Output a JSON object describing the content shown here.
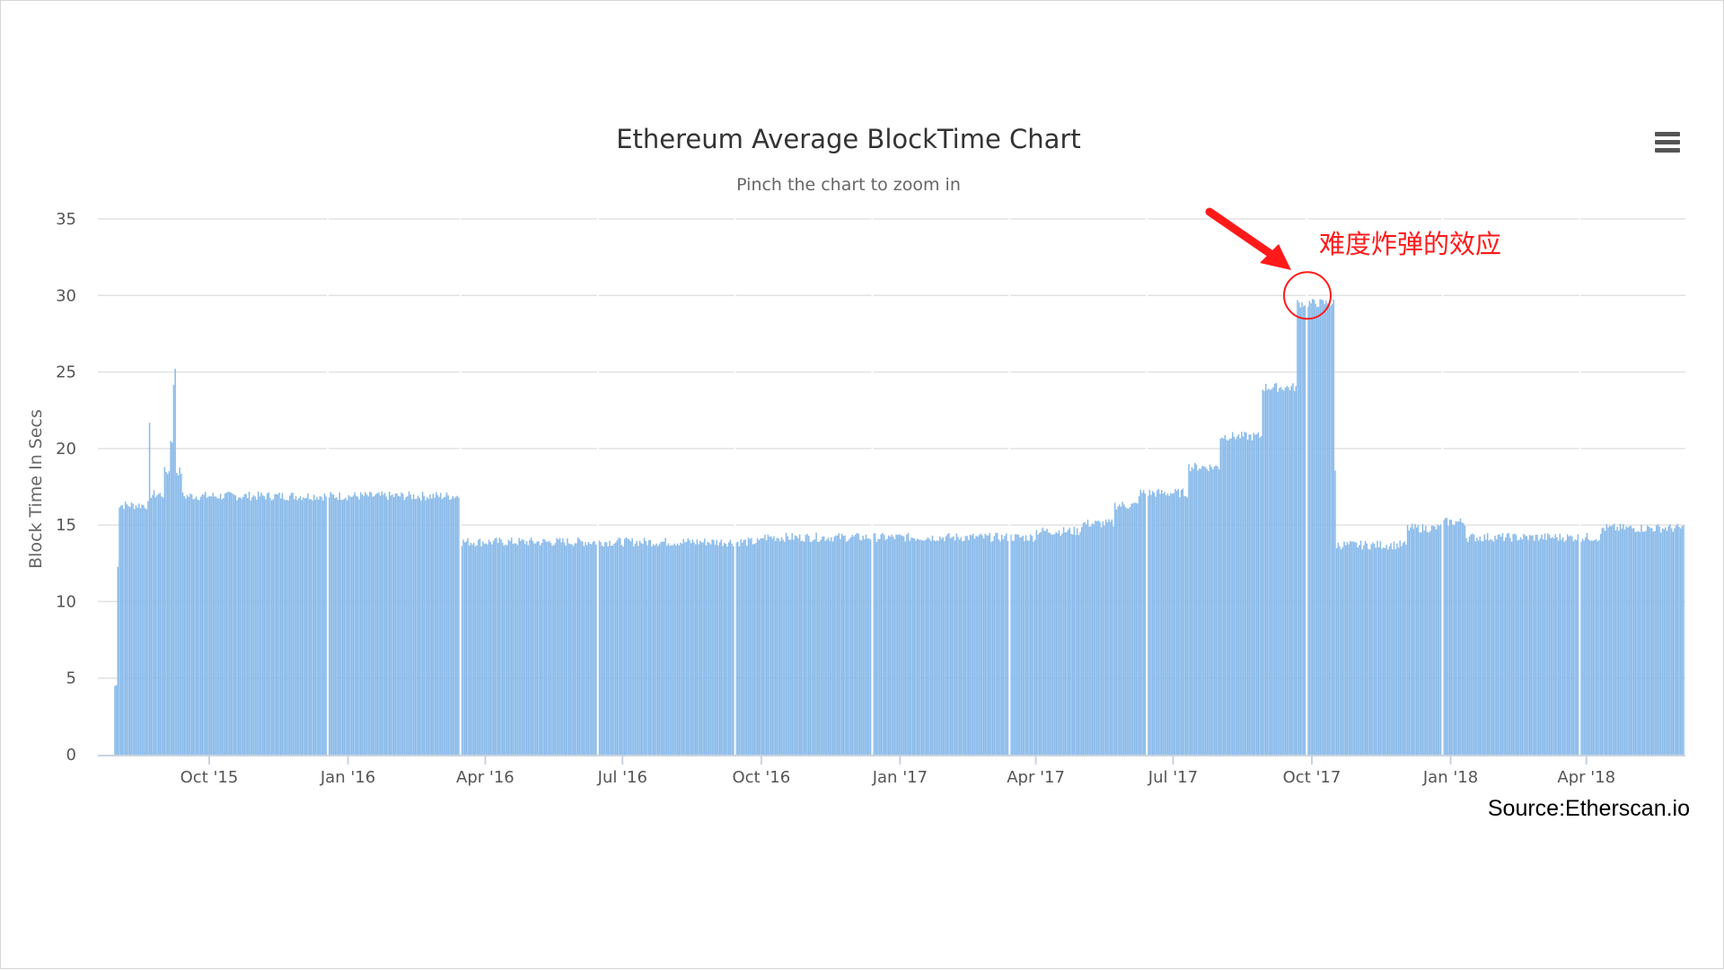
{
  "chart_data": {
    "type": "bar",
    "title": "Ethereum Average BlockTime Chart",
    "subtitle": "Pinch the chart to zoom in",
    "ylabel": "Block Time In Secs",
    "xlabel": "",
    "ylim": [
      0,
      35
    ],
    "yticks": [
      "0",
      "5",
      "10",
      "15",
      "20",
      "25",
      "30",
      "35"
    ],
    "xticks": [
      {
        "label": "Oct '15",
        "date": "2015-10-01"
      },
      {
        "label": "Jan '16",
        "date": "2016-01-01"
      },
      {
        "label": "Apr '16",
        "date": "2016-04-01"
      },
      {
        "label": "Jul '16",
        "date": "2016-07-01"
      },
      {
        "label": "Oct '16",
        "date": "2016-10-01"
      },
      {
        "label": "Jan '17",
        "date": "2017-01-01"
      },
      {
        "label": "Apr '17",
        "date": "2017-04-01"
      },
      {
        "label": "Jul '17",
        "date": "2017-07-01"
      },
      {
        "label": "Oct '17",
        "date": "2017-10-01"
      },
      {
        "label": "Jan '18",
        "date": "2018-01-01"
      },
      {
        "label": "Apr '18",
        "date": "2018-04-01"
      }
    ],
    "xrange": [
      "2015-07-30",
      "2018-06-04"
    ],
    "grid": true,
    "legend": "none",
    "color": "#8bbbea",
    "series": [
      {
        "frequency": "daily",
        "segments": [
          {
            "from": "2015-07-30",
            "to": "2015-07-31",
            "value": 4.5
          },
          {
            "from": "2015-08-01",
            "to": "2015-08-01",
            "value": 12.5
          },
          {
            "from": "2015-08-02",
            "to": "2015-08-21",
            "value": 16.3
          },
          {
            "from": "2015-08-22",
            "to": "2015-08-22",
            "value": 21.4
          },
          {
            "from": "2015-08-23",
            "to": "2015-08-31",
            "value": 17.0
          },
          {
            "from": "2015-09-01",
            "to": "2015-09-04",
            "value": 18.5
          },
          {
            "from": "2015-09-05",
            "to": "2015-09-06",
            "value": 20.6
          },
          {
            "from": "2015-09-07",
            "to": "2015-09-07",
            "value": 24.0
          },
          {
            "from": "2015-09-08",
            "to": "2015-09-08",
            "value": 25.3
          },
          {
            "from": "2015-09-09",
            "to": "2015-09-12",
            "value": 18.5
          },
          {
            "from": "2015-09-13",
            "to": "2016-03-14",
            "value": 16.9
          },
          {
            "from": "2016-03-15",
            "to": "2016-09-30",
            "value": 13.9
          },
          {
            "from": "2016-10-01",
            "to": "2017-03-31",
            "value": 14.2
          },
          {
            "from": "2017-04-01",
            "to": "2017-04-30",
            "value": 14.6
          },
          {
            "from": "2017-05-01",
            "to": "2017-05-22",
            "value": 15.1
          },
          {
            "from": "2017-05-23",
            "to": "2017-06-07",
            "value": 16.3
          },
          {
            "from": "2017-06-08",
            "to": "2017-07-10",
            "value": 17.1
          },
          {
            "from": "2017-07-11",
            "to": "2017-07-31",
            "value": 18.8
          },
          {
            "from": "2017-08-01",
            "to": "2017-08-28",
            "value": 20.8
          },
          {
            "from": "2017-08-29",
            "to": "2017-09-20",
            "value": 24.0
          },
          {
            "from": "2017-09-21",
            "to": "2017-10-15",
            "value": 29.5
          },
          {
            "from": "2017-10-16",
            "to": "2017-10-16",
            "value": 18.5
          },
          {
            "from": "2017-10-17",
            "to": "2017-12-02",
            "value": 13.7
          },
          {
            "from": "2017-12-03",
            "to": "2017-12-24",
            "value": 14.8
          },
          {
            "from": "2017-12-25",
            "to": "2018-01-10",
            "value": 15.2
          },
          {
            "from": "2018-01-11",
            "to": "2018-04-10",
            "value": 14.2
          },
          {
            "from": "2018-04-11",
            "to": "2018-06-04",
            "value": 14.8
          }
        ]
      }
    ]
  },
  "annotation": {
    "text": "难度炸弹的效应",
    "target_date": "2017-09-28",
    "target_value": 30,
    "color": "#ff1a1a"
  },
  "source_text": "Source:Etherscan.io",
  "menu_icon": "hamburger-menu-icon"
}
